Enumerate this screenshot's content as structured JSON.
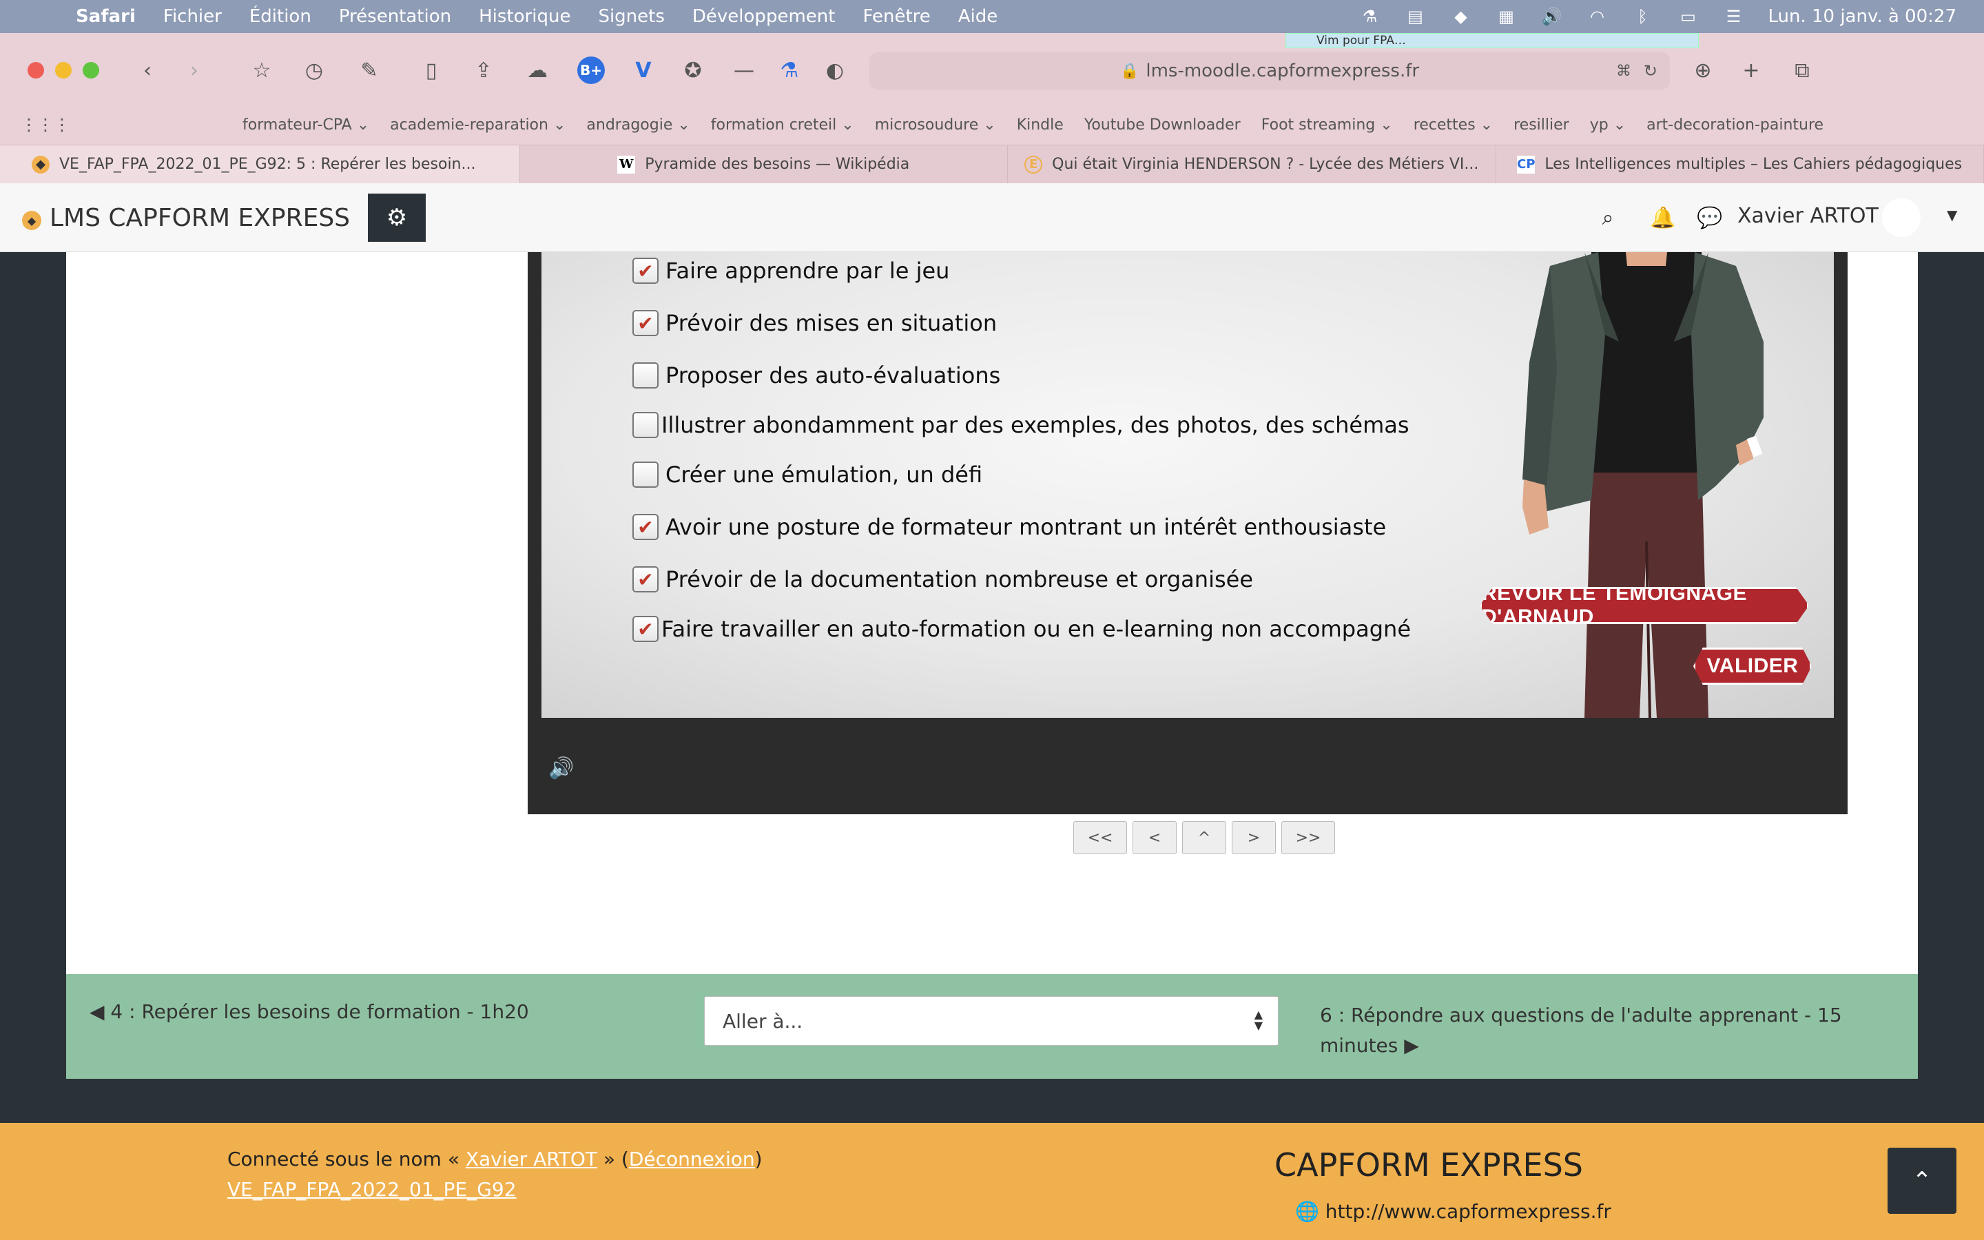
{
  "menubar": {
    "app": "Safari",
    "items": [
      "Fichier",
      "Édition",
      "Présentation",
      "Historique",
      "Signets",
      "Développement",
      "Fenêtre",
      "Aide"
    ],
    "clock": "Lun. 10 janv. à  00:27"
  },
  "safari": {
    "vim_tip": "Vim pour FPA…",
    "url": "lms-moodle.capformexpress.fr",
    "favorites": [
      {
        "label": "formateur-CPA",
        "has_menu": true
      },
      {
        "label": "academie-reparation",
        "has_menu": true
      },
      {
        "label": "andragogie",
        "has_menu": true
      },
      {
        "label": "formation creteil",
        "has_menu": true
      },
      {
        "label": "microsoudure",
        "has_menu": true
      },
      {
        "label": "Kindle",
        "has_menu": false
      },
      {
        "label": "Youtube Downloader",
        "has_menu": false
      },
      {
        "label": "Foot streaming",
        "has_menu": true
      },
      {
        "label": "recettes",
        "has_menu": true
      },
      {
        "label": "resillier",
        "has_menu": false
      },
      {
        "label": "yp",
        "has_menu": true
      },
      {
        "label": "art-decoration-painture",
        "has_menu": false
      }
    ],
    "tabs": [
      {
        "title": "VE_FAP_FPA_2022_01_PE_G92: 5 : Repérer les besoin...",
        "icon": "moodle-icon",
        "active": true
      },
      {
        "title": "Pyramide des besoins — Wikipédia",
        "icon": "wikipedia-icon",
        "active": false
      },
      {
        "title": "Qui était Virginia HENDERSON ? - Lycée des Métiers VI...",
        "icon": "site-icon",
        "active": false
      },
      {
        "title": "Les Intelligences multiples – Les Cahiers pédagogiques",
        "icon": "cp-icon",
        "active": false
      }
    ]
  },
  "lms": {
    "title": "LMS CAPFORM EXPRESS",
    "user": "Xavier ARTOT"
  },
  "quiz": {
    "options": [
      {
        "label": "Faire apprendre par le jeu",
        "checked": true
      },
      {
        "label": "Prévoir des mises en situation",
        "checked": true
      },
      {
        "label": "Proposer des auto-évaluations",
        "checked": false
      },
      {
        "label": "Illustrer abondamment par des exemples, des photos, des schémas",
        "checked": false
      },
      {
        "label": "Créer une émulation, un défi",
        "checked": false
      },
      {
        "label": "Avoir une posture de formateur montrant un intérêt enthousiaste",
        "checked": true
      },
      {
        "label": "Prévoir de la documentation nombreuse et organisée",
        "checked": true
      },
      {
        "label": "Faire travailler en auto-formation ou en e-learning non accompagné",
        "checked": true
      }
    ],
    "revoir_label": "REVOIR LE TEMOIGNAGE D'ARNAUD",
    "valider_label": "VALIDER"
  },
  "player_nav": [
    "<<",
    "<",
    "^",
    ">",
    ">>"
  ],
  "activity_nav": {
    "prev": "◀ 4 : Repérer les besoins de formation - 1h20",
    "jump_placeholder": "Aller à...",
    "next": "6 : Répondre aux questions de l'adulte apprenant - 15 minutes ▶"
  },
  "footer": {
    "logged_in_prefix": "Connecté sous le nom « ",
    "user_link": "Xavier ARTOT",
    "middle": " » (",
    "logout": "Déconnexion",
    "suffix": ")",
    "course": "VE_FAP_FPA_2022_01_PE_G92",
    "brand": "CAPFORM EXPRESS",
    "url": "http://www.capformexpress.fr"
  },
  "colors": {
    "accent_red": "#b0282e",
    "nav_band": "#8fc2a2",
    "footer": "#f0b04d",
    "dark": "#2a3237"
  }
}
